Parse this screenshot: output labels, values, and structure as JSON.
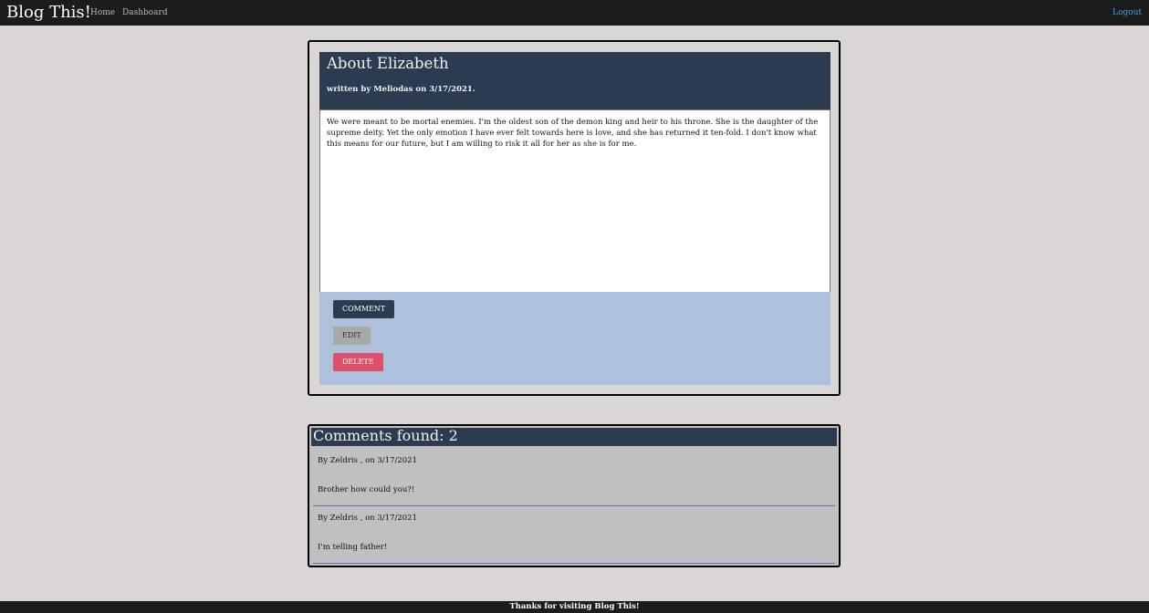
{
  "nav": {
    "brand": "Blog This!",
    "home": "Home",
    "dashboard": "Dashboard",
    "logout": "Logout"
  },
  "post": {
    "title": "About Elizabeth",
    "meta": "written by Meliodas on 3/17/2021.",
    "body": "We were meant to be mortal enemies. I'm the oldest son of the demon king and heir to his throne. She is the daughter of the supreme deity. Yet the only emotion I have ever felt towards here is love, and she has returned it ten-fold. I don't know what this means for our future, but I am willing to risk it all for her as she is for me.",
    "buttons": {
      "comment": "Comment",
      "edit": "Edit",
      "delete": "Delete"
    }
  },
  "comments": {
    "title": "Comments found: 2",
    "items": [
      {
        "author": "By Zeldris , on 3/17/2021",
        "text": "Brother how could you?!"
      },
      {
        "author": "By Zeldris , on 3/17/2021",
        "text": "I'm telling father!"
      }
    ]
  },
  "footer": {
    "text": "Thanks for visiting Blog This!"
  },
  "colors": {
    "navbar": "#1c1c1c",
    "header": "#2c3b50",
    "actions_bg": "#adc1dd",
    "delete": "#e04f6a",
    "logout_link": "#3aa3e3"
  }
}
